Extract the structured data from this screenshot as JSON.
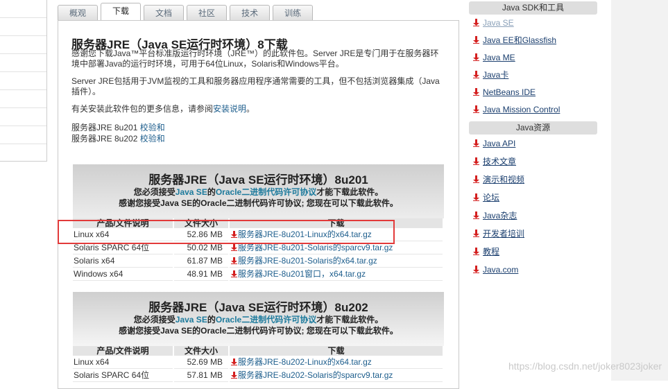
{
  "tabs": [
    "概观",
    "下载",
    "文档",
    "社区",
    "技术",
    "训练"
  ],
  "active_tab": "下载",
  "page": {
    "title": "服务器JRE（Java SE运行时环境）8下载",
    "intro1": "感谢您下载Java™平台标准版运行时环境（JRE™）的此软件包。Server JRE是专门用于在服务器环境中部署Java的运行时环境，可用于64位Linux，Solaris和Windows平台。",
    "intro2": "Server JRE包括用于JVM监视的工具和服务器应用程序通常需要的工具，但不包括浏览器集成（Java插件）。",
    "intro3_prefix": "有关安装此软件包的更多信息，请参阅",
    "intro3_link": "安装说明",
    "intro3_suffix": "。",
    "checksum1_prefix": "服务器JRE 8u201 ",
    "checksum2_prefix": "服务器JRE 8u202 ",
    "checksum_link": "校验和"
  },
  "table_headers": {
    "product": "产品/文件说明",
    "size": "文件大小",
    "download": "下载"
  },
  "license_line1": {
    "pre": "您必须接受",
    "java_se": "Java SE",
    "mid": "的",
    "link": "Oracle二进制代码许可协议",
    "post": "才能下载此软件。"
  },
  "license_line2": "感谢您接受Java SE的Oracle二进制代码许可协议; 您现在可以下载此软件。",
  "sections": [
    {
      "title": "服务器JRE（Java SE运行时环境）8u201",
      "rows": [
        {
          "product": "Linux x64",
          "size": "52.86 MB",
          "file": "服务器JRE-8u201-Linux的x64.tar.gz"
        },
        {
          "product": "Solaris SPARC 64位",
          "size": "50.02 MB",
          "file": "服务器JRE-8u201-Solaris的sparcv9.tar.gz"
        },
        {
          "product": "Solaris x64",
          "size": "61.87 MB",
          "file": "服务器JRE-8u201-Solaris的x64.tar.gz"
        },
        {
          "product": "Windows x64",
          "size": "48.91 MB",
          "file": "服务器JRE-8u201窗口，x64.tar.gz"
        }
      ]
    },
    {
      "title": "服务器JRE（Java SE运行时环境）8u202",
      "rows": [
        {
          "product": "Linux x64",
          "size": "52.69 MB",
          "file": "服务器JRE-8u202-Linux的x64.tar.gz"
        },
        {
          "product": "Solaris SPARC 64位",
          "size": "57.81 MB",
          "file": "服务器JRE-8u202-Solaris的sparcv9.tar.gz"
        }
      ]
    }
  ],
  "sidebar": {
    "sdk_title": "Java SDK和工具",
    "sdk_items": [
      "Java SE",
      "Java EE和Glassfish",
      "Java ME",
      "Java卡",
      "NetBeans IDE",
      "Java Mission Control"
    ],
    "res_title": "Java资源",
    "res_items": [
      "Java API",
      "技术文章",
      "演示和视频",
      "论坛",
      "Java杂志",
      "开发者培训",
      "教程",
      "Java.com"
    ]
  },
  "watermark": "https://blog.csdn.net/joker8023joker",
  "colors": {
    "link": "#1c5d8c",
    "download_icon": "#d42020",
    "highlight_box": "#e23a3a"
  },
  "icons": {
    "download": "download-arrow-icon"
  }
}
